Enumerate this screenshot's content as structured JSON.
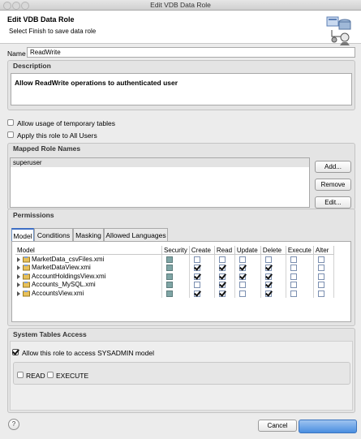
{
  "window": {
    "title": "Edit VDB Data Role"
  },
  "header": {
    "title": "Edit VDB Data Role",
    "subtitle": "Select Finish to save data role"
  },
  "name": {
    "label": "Name",
    "value": "ReadWrite"
  },
  "description": {
    "heading": "Description",
    "value": "Allow ReadWrite operations to authenticated user"
  },
  "options": {
    "temp_tables": "Allow usage of temporary tables",
    "all_users": "Apply this role to All Users"
  },
  "mapped_roles": {
    "heading": "Mapped Role Names",
    "items": [
      "superuser"
    ],
    "add": "Add...",
    "remove": "Remove",
    "edit": "Edit..."
  },
  "permissions": {
    "heading": "Permissions",
    "tabs": [
      "Model",
      "Conditions",
      "Masking",
      "Allowed Languages"
    ],
    "columns": [
      "Model",
      "Security",
      "Create",
      "Read",
      "Update",
      "Delete",
      "Execute",
      "Alter"
    ],
    "rows": [
      {
        "name": "MarketData_csvFiles.xmi",
        "security": true,
        "create": false,
        "read": false,
        "update": false,
        "delete": false,
        "execute": false,
        "alter": false
      },
      {
        "name": "MarketDataView.xmi",
        "security": true,
        "create": true,
        "read": true,
        "update": true,
        "delete": true,
        "execute": false,
        "alter": false
      },
      {
        "name": "AccountHoldingsView.xmi",
        "security": true,
        "create": true,
        "read": true,
        "update": true,
        "delete": true,
        "execute": false,
        "alter": false
      },
      {
        "name": "Accounts_MySQL.xmi",
        "security": true,
        "create": false,
        "read": true,
        "update": false,
        "delete": true,
        "execute": false,
        "alter": false
      },
      {
        "name": "AccountsView.xmi",
        "security": true,
        "create": true,
        "read": true,
        "update": false,
        "delete": true,
        "execute": false,
        "alter": false
      }
    ]
  },
  "system_tables": {
    "heading": "System Tables Access",
    "allow": "Allow this role to access SYSADMIN model",
    "read": "READ",
    "execute": "EXECUTE"
  },
  "footer": {
    "cancel": "Cancel",
    "help": "?"
  }
}
